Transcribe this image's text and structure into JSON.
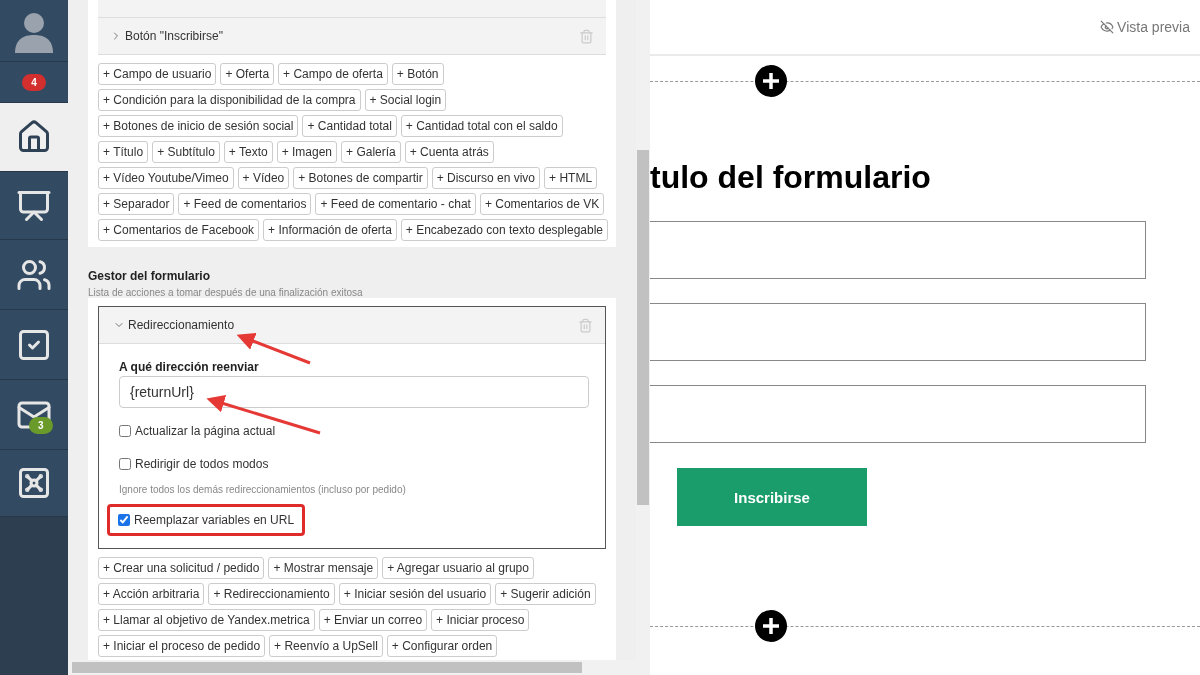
{
  "sidebar": {
    "items": [
      {
        "kind": "avatar",
        "selected": false
      },
      {
        "kind": "count",
        "badge": "4",
        "selected": false
      },
      {
        "kind": "home",
        "selected": true
      },
      {
        "kind": "chart",
        "selected": false
      },
      {
        "kind": "users",
        "selected": false
      },
      {
        "kind": "tasks",
        "selected": false
      },
      {
        "kind": "mail",
        "badge": "3",
        "selected": false
      },
      {
        "kind": "safe",
        "selected": false
      }
    ]
  },
  "editor": {
    "field_rows": [
      {
        "label": "Botón \"Inscribirse\"",
        "expanded": false
      }
    ],
    "field_buttons": [
      [
        "+ Campo de usuario",
        "+ Oferta",
        "+ Campo de oferta",
        "+ Botón"
      ],
      [
        "+ Condición para la disponibilidad de la compra",
        "+ Social login"
      ],
      [
        "+ Botones de inicio de sesión social",
        "+ Cantidad total",
        "+ Cantidad total con el saldo"
      ],
      [
        "+ Título",
        "+ Subtítulo",
        "+ Texto",
        "+ Imagen",
        "+ Galería",
        "+ Cuenta atrás"
      ],
      [
        "+ Vídeo Youtube/Vimeo",
        "+ Vídeo",
        "+ Botones de compartir",
        "+ Discurso en vivo",
        "+ HTML"
      ],
      [
        "+ Separador",
        "+ Feed de comentarios",
        "+ Feed de comentario - chat",
        "+ Comentarios de VK"
      ],
      [
        "+ Comentarios de Facebook",
        "+ Información de oferta",
        "+ Encabezado con texto desplegable"
      ]
    ],
    "handler": {
      "title": "Gestor del formulario",
      "subtitle": "Lista de acciones a tomar después de una finalización exitosa",
      "action": {
        "label": "Redireccionamiento",
        "expanded": true,
        "field_label": "A qué dirección reenviar",
        "field_value": "{returnUrl}",
        "options": [
          {
            "label": "Actualizar la página actual",
            "checked": false,
            "highlighted": false
          },
          {
            "label": "Redirigir de todos modos",
            "checked": false,
            "highlighted": false,
            "hint": "Ignore todos los demás redireccionamientos (incluso por pedido)"
          },
          {
            "label": "Reemplazar variables en URL",
            "checked": true,
            "highlighted": true
          }
        ]
      },
      "action_buttons": [
        [
          "+ Crear una solicitud / pedido",
          "+ Mostrar mensaje",
          "+ Agregar usuario al grupo"
        ],
        [
          "+ Acción arbitraria",
          "+ Redireccionamiento",
          "+ Iniciar sesión del usuario",
          "+ Sugerir adición"
        ],
        [
          "+ Llamar al objetivo de Yandex.metrica",
          "+ Enviar un correo",
          "+ Iniciar proceso"
        ],
        [
          "+ Iniciar el proceso de pedido",
          "+ Reenvío a UpSell",
          "+ Configurar orden"
        ]
      ]
    }
  },
  "preview": {
    "link": "Vista previa",
    "title": "tulo del formulario",
    "button": "Inscribirse"
  }
}
